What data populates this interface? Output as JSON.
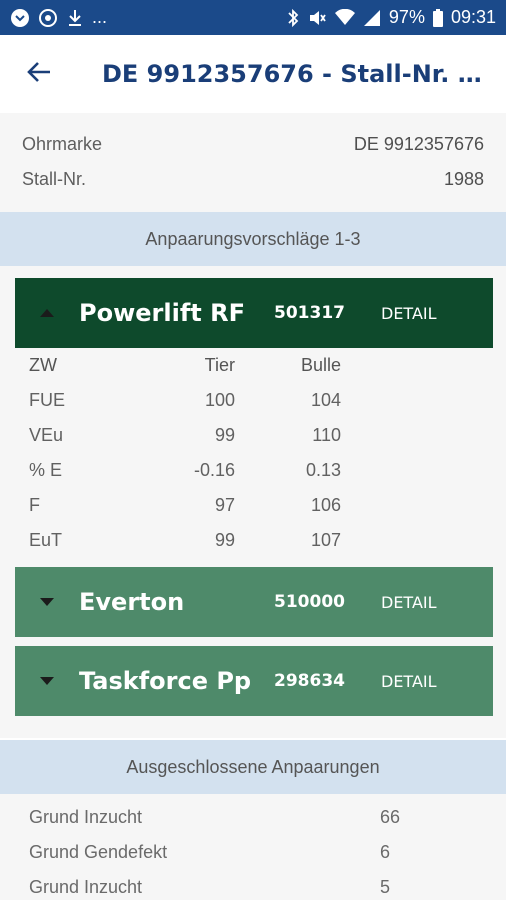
{
  "status_bar": {
    "time": "09:31",
    "battery": "97%",
    "left_text": "..."
  },
  "app_bar": {
    "title": "DE 9912357676 - Stall-Nr. 1988"
  },
  "info": {
    "rows": [
      {
        "label": "Ohrmarke",
        "value": "DE 9912357676"
      },
      {
        "label": "Stall-Nr.",
        "value": "1988"
      }
    ]
  },
  "suggestions": {
    "header": "Anpaarungsvorschläge 1-3",
    "detail_label": "DETAIL",
    "items": [
      {
        "name": "Powerlift RF",
        "number": "501317",
        "expanded": true
      },
      {
        "name": "Everton",
        "number": "510000",
        "expanded": false
      },
      {
        "name": "Taskforce Pp",
        "number": "298634",
        "expanded": false
      }
    ],
    "table": {
      "headers": [
        "ZW",
        "Tier",
        "Bulle"
      ],
      "rows": [
        [
          "FUE",
          "100",
          "104"
        ],
        [
          "VEu",
          "99",
          "110"
        ],
        [
          "% E",
          "-0.16",
          "0.13"
        ],
        [
          "F",
          "97",
          "106"
        ],
        [
          "EuT",
          "99",
          "107"
        ]
      ]
    }
  },
  "excluded": {
    "header": "Ausgeschlossene Anpaarungen",
    "rows": [
      {
        "label": "Grund Inzucht",
        "count": "66"
      },
      {
        "label": "Grund Gendefekt",
        "count": "6"
      },
      {
        "label": "Grund Inzucht",
        "count": "5"
      }
    ]
  },
  "colors": {
    "status_bar": "#1b4a8a",
    "title": "#1a3e78",
    "card_active": "#0e4a2c",
    "card_inactive": "#4e8a6a",
    "section_header": "#d3e1ef"
  }
}
